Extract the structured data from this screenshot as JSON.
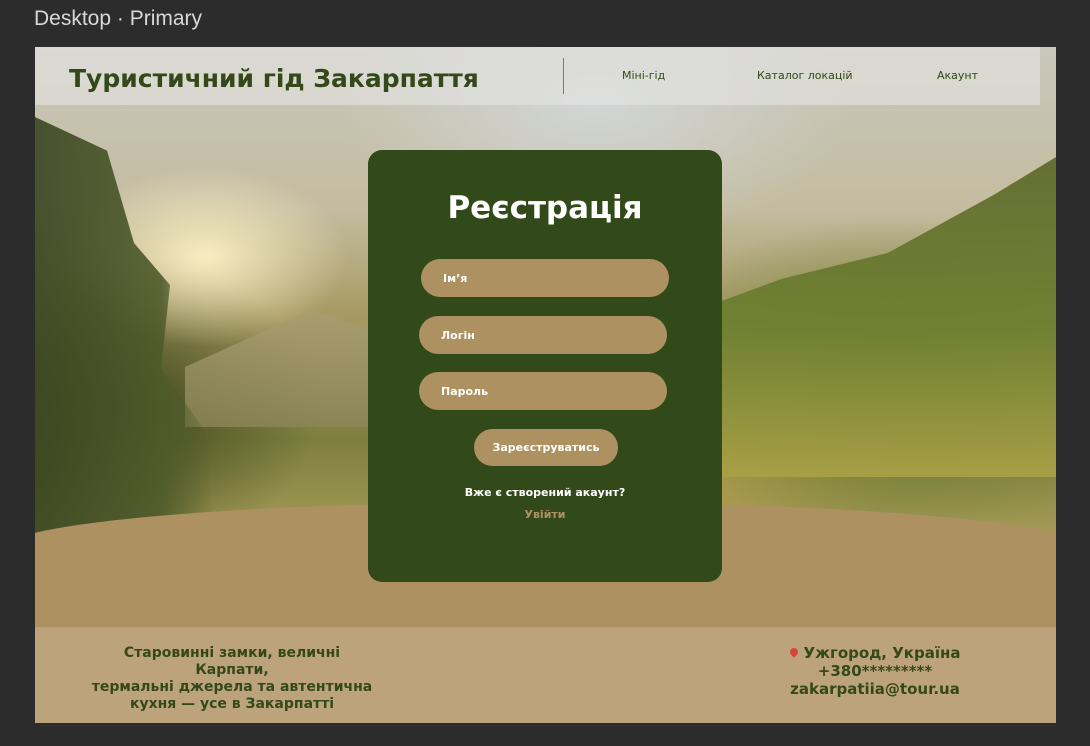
{
  "frame_label": "Desktop · Primary",
  "header": {
    "title": "Туристичний гід Закарпаття",
    "nav": {
      "mini_guide": "Міні-гід",
      "catalog": "Каталог локацій",
      "account": "Акаунт"
    }
  },
  "registration": {
    "title": "Реєстрація",
    "name_placeholder": "Ім’я",
    "login_placeholder": "Логін",
    "password_placeholder": "Пароль",
    "submit_label": "Зареєструватись",
    "has_account_text": "Вже є створений акаунт?",
    "login_link": "Увійти"
  },
  "footer": {
    "tagline_lines": [
      "Старовинні замки, величні Карпати,",
      "термальні джерела та автентична",
      "кухня — усе в Закарпатті"
    ],
    "location": "Ужгород, Україна",
    "phone": "+380*********",
    "email": "zakarpatiia@tour.ua"
  },
  "colors": {
    "primary_green": "#324a19",
    "accent_tan": "#ae9160",
    "footer_bg": "#bca37c"
  },
  "icons": {
    "location": "map-pin-icon"
  }
}
